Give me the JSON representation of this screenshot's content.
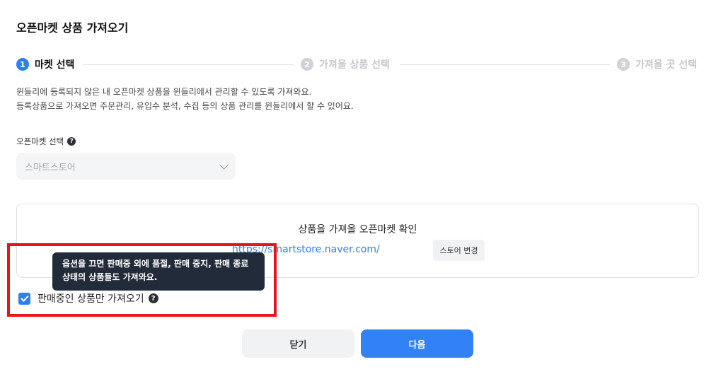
{
  "title": "오픈마켓 상품 가져오기",
  "steps": [
    {
      "num": "1",
      "label": "마켓 선택"
    },
    {
      "num": "2",
      "label": "가져올 상품 선택"
    },
    {
      "num": "3",
      "label": "가져올 곳 선택"
    }
  ],
  "description": {
    "line1": "윈들리에 등록되지 않은 내 오픈마켓 상품을 윈들리에서 관리할 수 있도록 가져와요.",
    "line2": "등록상품으로 가져오면 주문관리, 유입수 분석, 수집 등의 상품 관리를 윈들리에서 할 수 있어요."
  },
  "market_select": {
    "label": "오픈마켓 선택",
    "value": "스마트스토어"
  },
  "card": {
    "title": "상품을 가져올 오픈마켓 확인",
    "url": "https://smartstore.naver.com/",
    "store_change_label": "스토어 변경"
  },
  "tooltip": {
    "line1": "옵션을 끄면 판매중 외에 품절, 판매 중지, 판매 종료",
    "line2": "상태의 상품들도 가져와요."
  },
  "checkbox": {
    "label": "판매중인 상품만 가져오기",
    "checked": true
  },
  "buttons": {
    "close": "닫기",
    "next": "다음"
  },
  "colors": {
    "accent": "#3182f6",
    "highlight": "#e8141b",
    "tooltip_bg": "#222b3a"
  }
}
